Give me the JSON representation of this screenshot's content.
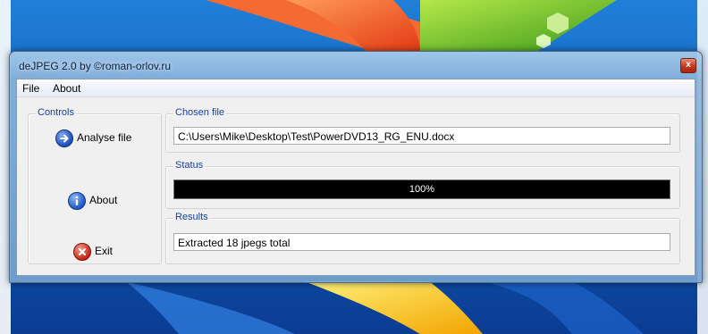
{
  "window": {
    "title": "deJPEG 2.0 by ©roman-orlov.ru",
    "close_glyph": "x"
  },
  "menu": [
    {
      "label": "File"
    },
    {
      "label": "About"
    }
  ],
  "controls": {
    "legend": "Controls",
    "buttons": [
      {
        "label": "Analyse file",
        "icon": "arrow-right-icon"
      },
      {
        "label": "About",
        "icon": "info-icon"
      },
      {
        "label": "Exit",
        "icon": "close-icon"
      }
    ]
  },
  "chosen_file": {
    "legend": "Chosen file",
    "value": "C:\\Users\\Mike\\Desktop\\Test\\PowerDVD13_RG_ENU.docx"
  },
  "status": {
    "legend": "Status",
    "progress_text": "100%",
    "progress_fraction": 1.0
  },
  "results": {
    "legend": "Results",
    "value": "Extracted 18 jpegs total"
  },
  "colors": {
    "accent": "#1a3f9a",
    "progress_bg": "#000000",
    "wallpaper": "#0c4fa8"
  }
}
